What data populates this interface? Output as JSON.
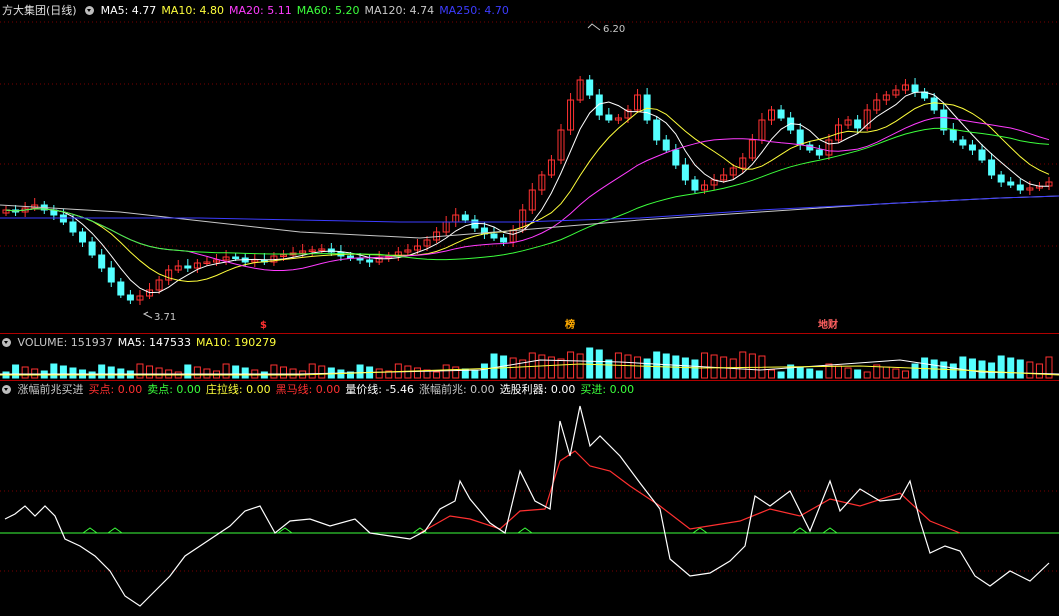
{
  "main": {
    "title": "方大集团(日线)",
    "ma": [
      {
        "label": "MA5: 4.77",
        "color": "#ffffff"
      },
      {
        "label": "MA10: 4.80",
        "color": "#ffff3c"
      },
      {
        "label": "MA20: 5.11",
        "color": "#ff3cff"
      },
      {
        "label": "MA60: 5.20",
        "color": "#3cff3c"
      },
      {
        "label": "MA120: 4.74",
        "color": "#c8c8c8"
      },
      {
        "label": "MA250: 4.70",
        "color": "#3c3cff"
      }
    ],
    "high_label": "6.20",
    "low_label": "3.71",
    "markers": [
      {
        "text": "$",
        "color": "#ff3030"
      },
      {
        "text": "榜",
        "color": "#ffaa00"
      },
      {
        "text": "地财",
        "color": "#ff6060"
      }
    ]
  },
  "volume": {
    "items": [
      {
        "label": "VOLUME: 151937",
        "color": "#c8c8c8"
      },
      {
        "label": "MA5: 147533",
        "color": "#ffffff"
      },
      {
        "label": "MA10: 190279",
        "color": "#ffff3c"
      }
    ]
  },
  "indicator": {
    "items": [
      {
        "label": "涨幅前兆买进",
        "color": "#c8c8c8"
      },
      {
        "label": "买点: 0.00",
        "color": "#ff3030"
      },
      {
        "label": "卖点: 0.00",
        "color": "#3cff3c"
      },
      {
        "label": "庄拉线: 0.00",
        "color": "#ffff3c"
      },
      {
        "label": "黑马线: 0.00",
        "color": "#ff3030"
      },
      {
        "label": "量价线: -5.46",
        "color": "#ffffff"
      },
      {
        "label": "涨幅前兆: 0.00",
        "color": "#c8c8c8"
      },
      {
        "label": "选股利器: 0.00",
        "color": "#ffffff"
      },
      {
        "label": "买进: 0.00",
        "color": "#3cff3c"
      }
    ]
  },
  "colors": {
    "up": "#ff3232",
    "down": "#54ffff",
    "grid": "#7a0000",
    "ma5": "#ffffff",
    "ma10": "#ffff3c",
    "ma20": "#ff3cff",
    "ma60": "#3cff3c",
    "ma120": "#c8c8c8",
    "ma250": "#3c3cff"
  }
}
